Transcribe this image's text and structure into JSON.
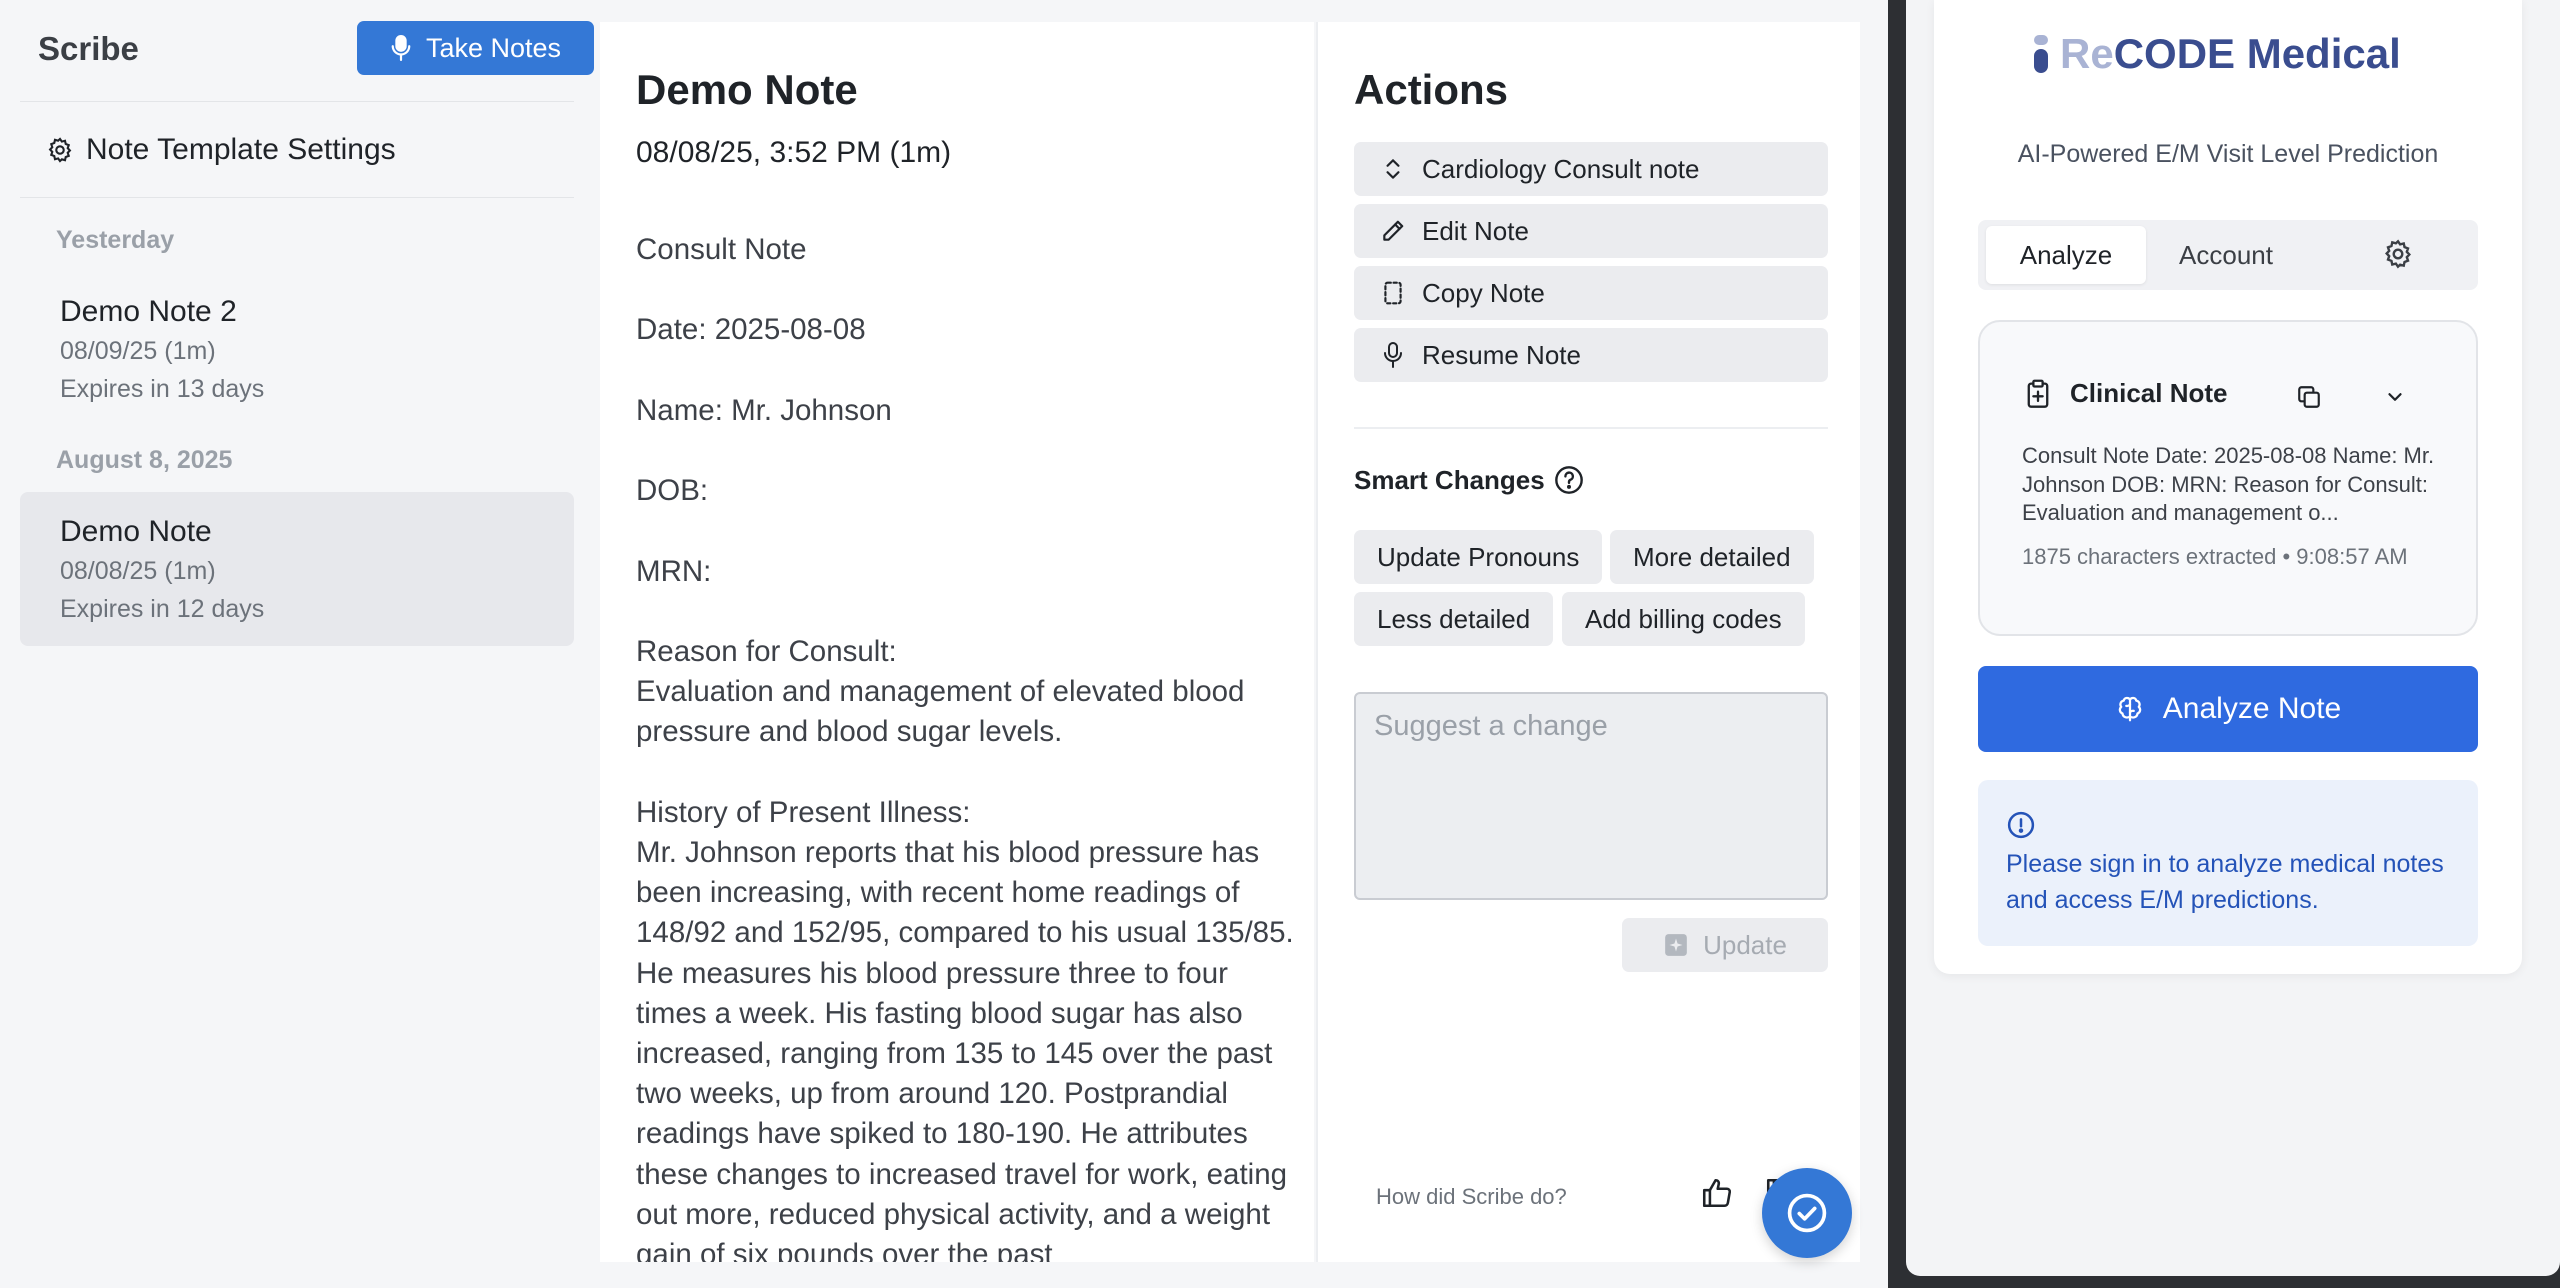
{
  "sidebar": {
    "app_title": "Scribe",
    "take_notes_label": "Take Notes",
    "settings_label": "Note Template Settings",
    "groups": [
      {
        "label": "Yesterday",
        "notes": [
          {
            "title": "Demo Note 2",
            "date": "08/09/25 (1m)",
            "expires": "Expires in 13 days"
          }
        ]
      },
      {
        "label": "August 8, 2025",
        "notes": [
          {
            "title": "Demo Note",
            "date": "08/08/25 (1m)",
            "expires": "Expires in 12 days",
            "active": true
          }
        ]
      }
    ]
  },
  "note": {
    "title": "Demo Note",
    "datetime": "08/08/25, 3:52 PM (1m)",
    "body": "Consult Note\n\nDate: 2025-08-08\n\nName: Mr. Johnson\n\nDOB:\n\nMRN:\n\nReason for Consult:\nEvaluation and management of elevated blood pressure and blood sugar levels.\n\nHistory of Present Illness:\nMr. Johnson reports that his blood pressure has been increasing, with recent home readings of 148/92 and 152/95, compared to his usual 135/85. He measures his blood pressure three to four times a week. His fasting blood sugar has also increased, ranging from 135 to 145 over the past two weeks, up from around 120. Postprandial readings have spiked to 180-190. He attributes these changes to increased travel for work, eating out more, reduced physical activity, and a weight gain of six pounds over the past"
  },
  "actions": {
    "title": "Actions",
    "buttons": [
      {
        "label": "Cardiology Consult note",
        "icon": "chevron-updown-icon"
      },
      {
        "label": "Edit Note",
        "icon": "pencil-icon"
      },
      {
        "label": "Copy Note",
        "icon": "copy-icon"
      },
      {
        "label": "Resume Note",
        "icon": "microphone-icon"
      }
    ],
    "smart_changes_label": "Smart Changes",
    "chips": [
      "Update Pronouns",
      "More detailed",
      "Less detailed",
      "Add billing codes"
    ],
    "suggest_placeholder": "Suggest a change",
    "update_label": "Update",
    "feedback_label": "How did Scribe do?"
  },
  "extension": {
    "brand_prefix": "Re",
    "brand_rest": "CODE Medical",
    "subtitle": "AI-Powered E/M Visit Level Prediction",
    "tabs": [
      "Analyze",
      "Account"
    ],
    "clinical_note": {
      "label": "Clinical Note",
      "preview": "Consult Note Date: 2025-08-08 Name: Mr. Johnson DOB: MRN: Reason for Consult: Evaluation and management o...",
      "meta": "1875 characters extracted • 9:08:57 AM"
    },
    "analyze_label": "Analyze Note",
    "signin_message": "Please sign in to analyze medical notes and access E/M predictions."
  },
  "colors": {
    "primary_blue": "#3478d6",
    "analyze_blue": "#2f6ae0",
    "brand_navy": "#3a4d8f"
  }
}
